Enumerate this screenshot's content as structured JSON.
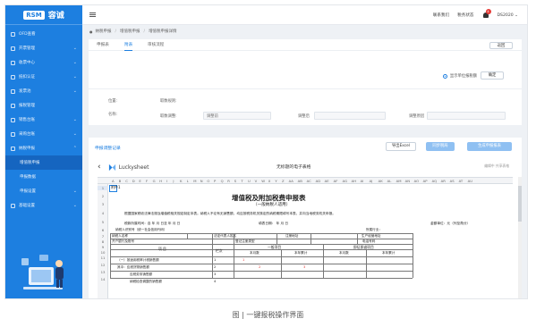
{
  "brand": {
    "short": "RSM",
    "name": "容诚",
    "color": "#1d7fe0"
  },
  "sidebar": {
    "items": [
      {
        "label": "OFD查看",
        "chev": ""
      },
      {
        "label": "开票管理",
        "chev": "⌄"
      },
      {
        "label": "收票中心",
        "chev": "⌄"
      },
      {
        "label": "抵扣认证",
        "chev": "⌄"
      },
      {
        "label": "发票池",
        "chev": "⌄"
      },
      {
        "label": "报税管理",
        "chev": ""
      },
      {
        "label": "销售台账",
        "chev": "⌄"
      },
      {
        "label": "采购台账",
        "chev": "⌄"
      },
      {
        "label": "纳税申报",
        "chev": "⌃"
      },
      {
        "label": "增值税申报",
        "chev": "",
        "sub": true,
        "active": true
      },
      {
        "label": "申报数据",
        "chev": "",
        "sub": true
      },
      {
        "label": "申报设置",
        "chev": "⌄",
        "sub": true
      },
      {
        "label": "基础设置",
        "chev": "⌄"
      }
    ]
  },
  "topbar": {
    "contact": "联系我们",
    "tax_status": "税务状态",
    "badge": "4",
    "user": "DS2020",
    "user_chev": "⌄"
  },
  "breadcrumb": [
    "纳税申报",
    "增值税申报",
    "增值税申报详情"
  ],
  "card1": {
    "tabs": [
      "申报表",
      "附表",
      "审核流程"
    ],
    "active_tab": 1,
    "return_btn": "返回",
    "radio_label": "显示单位报税额",
    "confirm_btn": "确定",
    "row1": {
      "label1": "位置:",
      "label2": "取数规则:"
    },
    "row2": {
      "label1": "名称:",
      "label2": "取数调整:",
      "ph2": "调整前",
      "label3": "调整后",
      "label4": "调整原因"
    }
  },
  "card2": {
    "title": "申报调整记录",
    "export_btn": "导出Excel",
    "sync_btn": "同步税局",
    "gen_btn": "生成申报报表",
    "ls_name": "Luckysheet",
    "doc_title": "无标题的电子表格",
    "ls_right": "编辑中 共享表格"
  },
  "sheet": {
    "cols": [
      "A",
      "B",
      "C",
      "D",
      "E",
      "F",
      "G",
      "H",
      "I",
      "J",
      "K",
      "L",
      "M",
      "N",
      "O",
      "P",
      "Q",
      "R",
      "S",
      "T",
      "U",
      "V",
      "W",
      "X",
      "Y",
      "Z",
      "AA",
      "AB",
      "AC",
      "AD",
      "AE",
      "AF",
      "AG",
      "AH",
      "AI",
      "AJ",
      "AK",
      "AL",
      "AM",
      "AN",
      "AO",
      "AP",
      "AQ",
      "AR",
      "AS",
      "AT",
      "AU"
    ],
    "rows": [
      "1",
      "2",
      "3",
      "4",
      "5",
      "6",
      "7",
      "8",
      "9",
      "10",
      "11",
      "12",
      "13",
      "14"
    ],
    "cell_a1": "附件1",
    "title": "增值税及附加税费申报表",
    "subtitle": "（一般纳税人适用）",
    "note": "根据国家税收法律法规及增值税相关规定制定本表。纳税人不论有无销售额，均应按税务机关核定的纳税期限填写本表，并向当地税务机关申报。",
    "period": "税款所属时间：自  年  月  日至  年  月  日",
    "fill_date": "填表日期：  年  月  日",
    "unit": "金额单位：元（列至角分）",
    "taxpayer_id": "纳税人识别号（统一社会信用代码）",
    "industry": "所属行业：",
    "taxpayer_name": "纳税人名称",
    "legal_rep": "法定代表人姓名",
    "reg_addr": "注册地址",
    "biz_addr": "生产经营地址",
    "bank": "开户银行及账号",
    "reg_type": "登记注册类型",
    "phone": "电话号码",
    "item_hdr": "项  目",
    "col_hdr": "栏次",
    "general": "一般项目",
    "immediate": "即征即退项目",
    "this_month": "本月数",
    "ytd": "本年累计",
    "this_month2": "本月数",
    "ytd2": "本年累计",
    "row11": "（一）按适用税率计税销售额",
    "row12": "其中：应税货物销售额",
    "row13": "应税劳务销售额",
    "row14": "纳税检查调整的销售额",
    "n1": "1",
    "n2": "2",
    "n3": "3",
    "n4": "4",
    "v1": "1",
    "v2": "2",
    "v3": "3",
    "v4": "4"
  },
  "caption": "图 | 一键报税操作界面"
}
